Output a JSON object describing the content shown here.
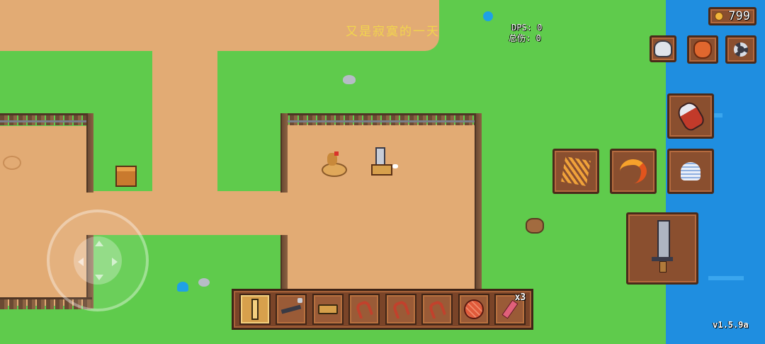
{
  "hud": {
    "coins": "799",
    "overlay_text": "又是寂寞的一天",
    "dps_label": "DPS: 0",
    "total_damage_label": "总伤: 0",
    "version": "v1.5.9a"
  },
  "hotbar": {
    "slots": [
      {
        "icon": "sword-icon",
        "selected": true
      },
      {
        "icon": "locked-gun-icon",
        "selected": false
      },
      {
        "icon": "pistol-icon",
        "selected": false
      },
      {
        "icon": "slingshot-icon",
        "selected": false
      },
      {
        "icon": "slingshot-icon",
        "selected": false
      },
      {
        "icon": "slingshot-icon",
        "selected": false
      },
      {
        "icon": "meat-icon",
        "selected": false
      },
      {
        "icon": "dynamite-icon",
        "selected": false,
        "count": "x3"
      }
    ]
  },
  "top_buttons": [
    "skull-icon",
    "bag-icon",
    "gear-icon"
  ],
  "skill_buttons": [
    "potion-icon",
    "wheat-icon",
    "fire-slash-icon",
    "ghost-dash-icon"
  ],
  "attack_button": "sword-attack-icon",
  "colors": {
    "grass": "#5fcb4c",
    "path": "#e2ab74",
    "water": "#1f8ee0",
    "panel": "#8a4f2f",
    "overlay_text": "#f3d94a"
  }
}
